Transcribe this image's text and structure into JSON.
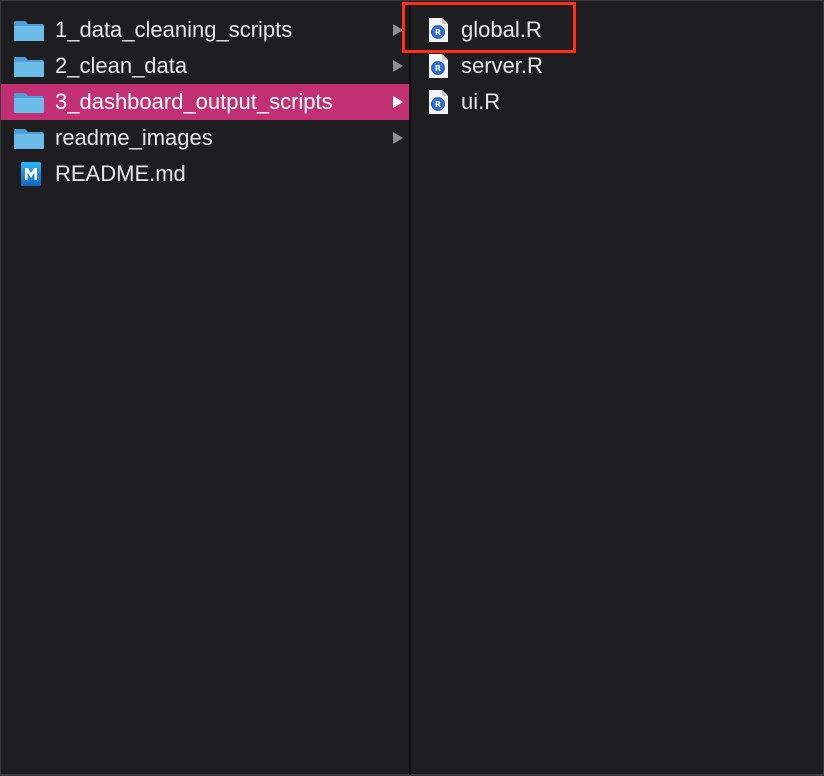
{
  "colors": {
    "background": "#1e1e20",
    "selection": "#c22f73",
    "text": "#e6e6e6",
    "folder": "#5fb3e6",
    "highlight_box": "#ff2d1a"
  },
  "column1": {
    "items": [
      {
        "label": "1_data_cleaning_scripts",
        "icon": "folder-icon",
        "has_children": true,
        "selected": false
      },
      {
        "label": "2_clean_data",
        "icon": "folder-icon",
        "has_children": true,
        "selected": false
      },
      {
        "label": "3_dashboard_output_scripts",
        "icon": "folder-icon",
        "has_children": true,
        "selected": true
      },
      {
        "label": "readme_images",
        "icon": "folder-icon",
        "has_children": true,
        "selected": false
      },
      {
        "label": "README.md",
        "icon": "markdown-file-icon",
        "has_children": false,
        "selected": false
      }
    ]
  },
  "column2": {
    "items": [
      {
        "label": "global.R",
        "icon": "r-file-icon",
        "highlighted": true
      },
      {
        "label": "server.R",
        "icon": "r-file-icon",
        "highlighted": false
      },
      {
        "label": "ui.R",
        "icon": "r-file-icon",
        "highlighted": false
      }
    ]
  }
}
